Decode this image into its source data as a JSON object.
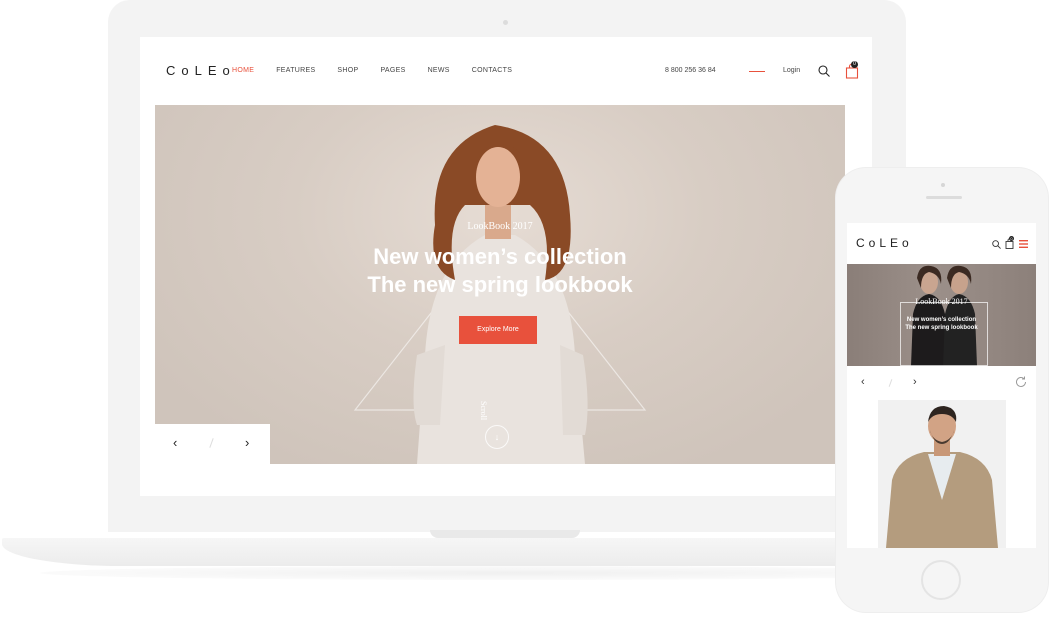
{
  "desktop": {
    "logo": "CoLEo",
    "nav": [
      {
        "label": "HOME",
        "active": true
      },
      {
        "label": "FEATURES",
        "active": false
      },
      {
        "label": "SHOP",
        "active": false
      },
      {
        "label": "PAGES",
        "active": false
      },
      {
        "label": "NEWS",
        "active": false
      },
      {
        "label": "CONTACTS",
        "active": false
      }
    ],
    "phone_number": "8 800 256 36 84",
    "login_label": "Login",
    "cart_count": "0",
    "hero": {
      "tag": "LookBook 2017",
      "title_line1": "New women’s collection",
      "title_line2": "The new spring lookbook",
      "button_label": "Explore More",
      "scroll_label": "Scroll"
    },
    "slider": {
      "prev_icon": "chevron-left-icon",
      "next_icon": "chevron-right-icon"
    }
  },
  "mobile": {
    "logo": "CoLEo",
    "cart_count": "0",
    "hero": {
      "tag": "LookBook 2017",
      "title_line1": "New women’s collection",
      "title_line2": "The new spring lookbook"
    }
  },
  "colors": {
    "accent": "#e8513c",
    "text": "#222222",
    "device": "#f3f3f3"
  }
}
